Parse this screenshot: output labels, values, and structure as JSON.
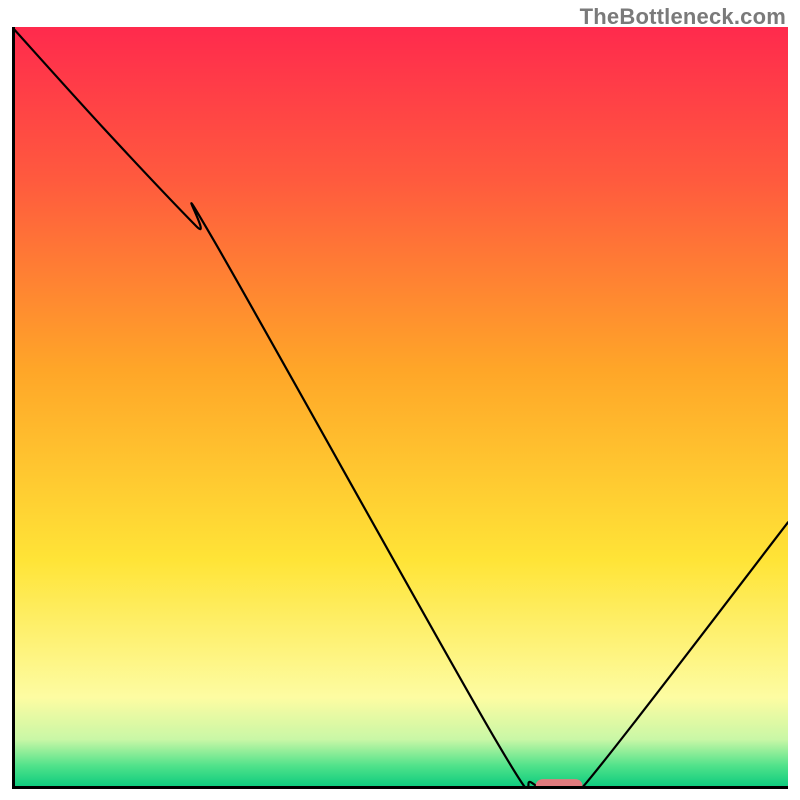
{
  "watermark": "TheBottleneck.com",
  "chart_data": {
    "type": "line",
    "title": "",
    "xlabel": "",
    "ylabel": "",
    "xlim": [
      0,
      100
    ],
    "ylim": [
      0,
      100
    ],
    "grid": false,
    "background": {
      "kind": "vertical-gradient",
      "stops": [
        {
          "pos": 0.0,
          "color": "#ff2a4d"
        },
        {
          "pos": 0.2,
          "color": "#ff5a3e"
        },
        {
          "pos": 0.45,
          "color": "#ffa628"
        },
        {
          "pos": 0.7,
          "color": "#ffe437"
        },
        {
          "pos": 0.88,
          "color": "#fdfca2"
        },
        {
          "pos": 0.935,
          "color": "#c9f7a6"
        },
        {
          "pos": 0.97,
          "color": "#4fe28a"
        },
        {
          "pos": 1.0,
          "color": "#06c97d"
        }
      ]
    },
    "series": [
      {
        "name": "bottleneck-curve",
        "x": [
          0.0,
          12.0,
          23.8,
          26.0,
          62.0,
          67.0,
          71.0,
          74.0,
          100.0
        ],
        "y": [
          100.0,
          86.5,
          73.8,
          72.0,
          7.0,
          0.8,
          0.0,
          0.8,
          35.0
        ]
      }
    ],
    "annotations": [
      {
        "name": "optimum-marker",
        "shape": "rounded-rect",
        "color": "#e17b7e",
        "x_center": 70.5,
        "y_center": 0.5,
        "width": 6.0,
        "height": 1.6
      }
    ]
  }
}
